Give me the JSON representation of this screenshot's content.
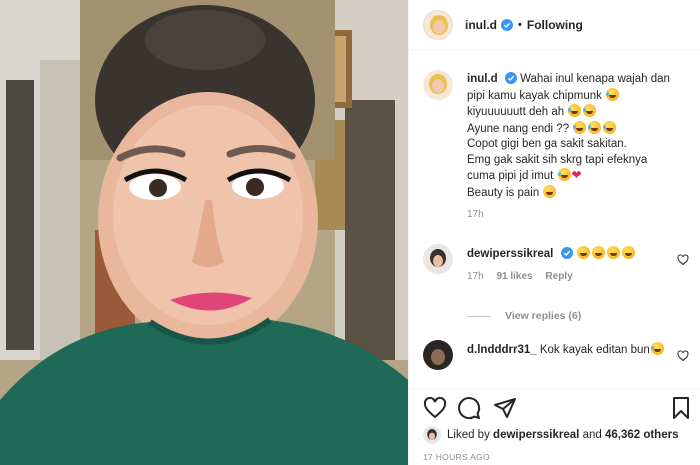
{
  "header": {
    "username": "inul.d",
    "follow_status": "Following",
    "separator": "•"
  },
  "caption": {
    "username": "inul.d",
    "line1": "Wahai inul kenapa wajah dan pipi kamu kayak chipmunk",
    "line2": "kiyuuuuuutt deh ah",
    "line3": "Ayune nang endi ??",
    "line4": "Copot gigi ben ga sakit sakitan.",
    "line5": "Emg gak sakit sih skrg tapi efeknya cuma pipi jd imut",
    "line6": "Beauty is pain",
    "time": "17h"
  },
  "comments": [
    {
      "username": "dewiperssikreal",
      "time": "17h",
      "likes": "91 likes",
      "reply": "Reply",
      "view_replies": "View replies (6)"
    },
    {
      "username": "d.lndddrr31_",
      "text": "Kok kayak editan bun"
    }
  ],
  "likes": {
    "prefix": "Liked by",
    "user": "dewiperssikreal",
    "and": "and",
    "others": "46,362 others"
  },
  "timeago": "17 HOURS AGO",
  "icons": {
    "verified": "verified-badge-icon",
    "like": "heart-outline-icon",
    "comment": "comment-bubble-icon",
    "share": "paper-plane-icon",
    "save": "bookmark-icon"
  },
  "colors": {
    "verified": "#3897f0",
    "text": "#262626",
    "muted": "#8e8e8e",
    "shirt": "#1e6a56",
    "lips": "#e0457a"
  }
}
